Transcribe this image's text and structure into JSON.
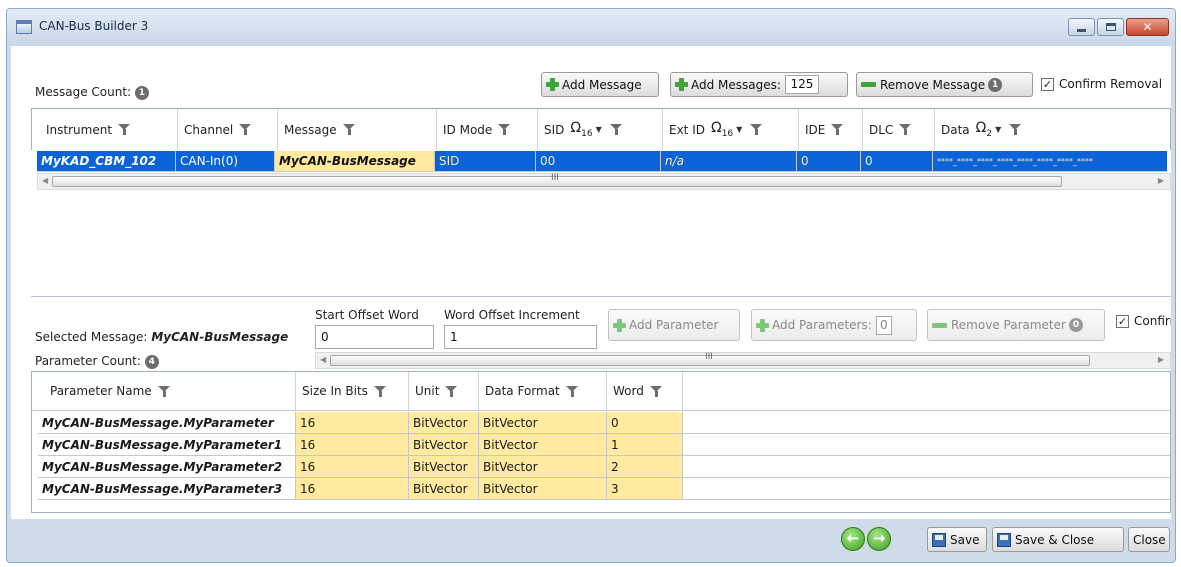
{
  "window": {
    "title": "CAN-Bus Builder 3"
  },
  "messages": {
    "count_label": "Message Count:",
    "count": "1",
    "add_message_label": "Add Message",
    "add_messages_label": "Add Messages:",
    "add_messages_count": "125",
    "remove_message_label": "Remove Message",
    "remove_message_count": "1",
    "confirm_removal_label": "Confirm Removal",
    "confirm_removal_checked": "✓",
    "columns": [
      "Instrument",
      "Channel",
      "Message",
      "ID Mode",
      "SID",
      "Ext ID",
      "IDE",
      "DLC",
      "Data"
    ],
    "omega_symbol": "Ω",
    "omega_sub_16": "16",
    "omega_sub_2": "2",
    "row": {
      "instrument": "MyKAD_CBM_102",
      "channel": "CAN-In(0)",
      "message": "MyCAN-BusMessage",
      "id_mode": "SID",
      "sid": "00",
      "ext_id": "n/a",
      "ide": "0",
      "dlc": "0",
      "data": "****_****_****_****_****_****_****_****"
    },
    "scroll_grip": "III"
  },
  "parameters": {
    "selected_label": "Selected Message:",
    "selected_value": "MyCAN-BusMessage",
    "count_label": "Parameter Count:",
    "count": "4",
    "start_offset_label": "Start Offset Word",
    "start_offset_value": "0",
    "word_increment_label": "Word Offset Increment",
    "word_increment_value": "1",
    "add_parameter_label": "Add Parameter",
    "add_parameters_label": "Add Parameters:",
    "add_parameters_count": "0",
    "remove_parameter_label": "Remove Parameter",
    "remove_parameter_count": "0",
    "confirm_label": "Confirm",
    "confirm_checked": "✓",
    "columns": [
      "Parameter Name",
      "Size In Bits",
      "Unit",
      "Data Format",
      "Word"
    ],
    "rows": [
      {
        "name": "MyCAN-BusMessage.MyParameter",
        "size": "16",
        "unit": "BitVector",
        "format": "BitVector",
        "word": "0"
      },
      {
        "name": "MyCAN-BusMessage.MyParameter1",
        "size": "16",
        "unit": "BitVector",
        "format": "BitVector",
        "word": "1"
      },
      {
        "name": "MyCAN-BusMessage.MyParameter2",
        "size": "16",
        "unit": "BitVector",
        "format": "BitVector",
        "word": "2"
      },
      {
        "name": "MyCAN-BusMessage.MyParameter3",
        "size": "16",
        "unit": "BitVector",
        "format": "BitVector",
        "word": "3"
      }
    ],
    "scroll_grip": "III"
  },
  "footer": {
    "back_glyph": "←",
    "forward_glyph": "→",
    "save_label": "Save",
    "save_close_label": "Save & Close",
    "close_label": "Close"
  },
  "colors": {
    "selection": "#0a63d8",
    "highlight_cell": "#ffeaa0",
    "accent_green": "#3ea43b"
  },
  "icons": [
    "app-icon",
    "minimize-icon",
    "maximize-icon",
    "close-icon",
    "filter-icon",
    "plus-icon",
    "minus-icon",
    "back-arrow-icon",
    "forward-arrow-icon",
    "save-icon"
  ]
}
